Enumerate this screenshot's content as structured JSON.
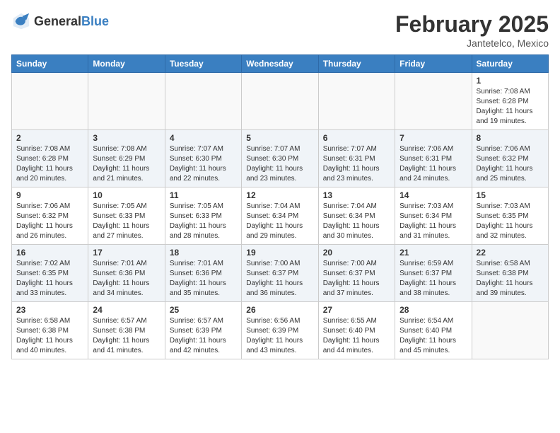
{
  "header": {
    "logo_general": "General",
    "logo_blue": "Blue",
    "month_year": "February 2025",
    "location": "Jantetelco, Mexico"
  },
  "days_of_week": [
    "Sunday",
    "Monday",
    "Tuesday",
    "Wednesday",
    "Thursday",
    "Friday",
    "Saturday"
  ],
  "weeks": [
    [
      {
        "day": "",
        "info": ""
      },
      {
        "day": "",
        "info": ""
      },
      {
        "day": "",
        "info": ""
      },
      {
        "day": "",
        "info": ""
      },
      {
        "day": "",
        "info": ""
      },
      {
        "day": "",
        "info": ""
      },
      {
        "day": "1",
        "info": "Sunrise: 7:08 AM\nSunset: 6:28 PM\nDaylight: 11 hours\nand 19 minutes."
      }
    ],
    [
      {
        "day": "2",
        "info": "Sunrise: 7:08 AM\nSunset: 6:28 PM\nDaylight: 11 hours\nand 20 minutes."
      },
      {
        "day": "3",
        "info": "Sunrise: 7:08 AM\nSunset: 6:29 PM\nDaylight: 11 hours\nand 21 minutes."
      },
      {
        "day": "4",
        "info": "Sunrise: 7:07 AM\nSunset: 6:30 PM\nDaylight: 11 hours\nand 22 minutes."
      },
      {
        "day": "5",
        "info": "Sunrise: 7:07 AM\nSunset: 6:30 PM\nDaylight: 11 hours\nand 23 minutes."
      },
      {
        "day": "6",
        "info": "Sunrise: 7:07 AM\nSunset: 6:31 PM\nDaylight: 11 hours\nand 23 minutes."
      },
      {
        "day": "7",
        "info": "Sunrise: 7:06 AM\nSunset: 6:31 PM\nDaylight: 11 hours\nand 24 minutes."
      },
      {
        "day": "8",
        "info": "Sunrise: 7:06 AM\nSunset: 6:32 PM\nDaylight: 11 hours\nand 25 minutes."
      }
    ],
    [
      {
        "day": "9",
        "info": "Sunrise: 7:06 AM\nSunset: 6:32 PM\nDaylight: 11 hours\nand 26 minutes."
      },
      {
        "day": "10",
        "info": "Sunrise: 7:05 AM\nSunset: 6:33 PM\nDaylight: 11 hours\nand 27 minutes."
      },
      {
        "day": "11",
        "info": "Sunrise: 7:05 AM\nSunset: 6:33 PM\nDaylight: 11 hours\nand 28 minutes."
      },
      {
        "day": "12",
        "info": "Sunrise: 7:04 AM\nSunset: 6:34 PM\nDaylight: 11 hours\nand 29 minutes."
      },
      {
        "day": "13",
        "info": "Sunrise: 7:04 AM\nSunset: 6:34 PM\nDaylight: 11 hours\nand 30 minutes."
      },
      {
        "day": "14",
        "info": "Sunrise: 7:03 AM\nSunset: 6:34 PM\nDaylight: 11 hours\nand 31 minutes."
      },
      {
        "day": "15",
        "info": "Sunrise: 7:03 AM\nSunset: 6:35 PM\nDaylight: 11 hours\nand 32 minutes."
      }
    ],
    [
      {
        "day": "16",
        "info": "Sunrise: 7:02 AM\nSunset: 6:35 PM\nDaylight: 11 hours\nand 33 minutes."
      },
      {
        "day": "17",
        "info": "Sunrise: 7:01 AM\nSunset: 6:36 PM\nDaylight: 11 hours\nand 34 minutes."
      },
      {
        "day": "18",
        "info": "Sunrise: 7:01 AM\nSunset: 6:36 PM\nDaylight: 11 hours\nand 35 minutes."
      },
      {
        "day": "19",
        "info": "Sunrise: 7:00 AM\nSunset: 6:37 PM\nDaylight: 11 hours\nand 36 minutes."
      },
      {
        "day": "20",
        "info": "Sunrise: 7:00 AM\nSunset: 6:37 PM\nDaylight: 11 hours\nand 37 minutes."
      },
      {
        "day": "21",
        "info": "Sunrise: 6:59 AM\nSunset: 6:37 PM\nDaylight: 11 hours\nand 38 minutes."
      },
      {
        "day": "22",
        "info": "Sunrise: 6:58 AM\nSunset: 6:38 PM\nDaylight: 11 hours\nand 39 minutes."
      }
    ],
    [
      {
        "day": "23",
        "info": "Sunrise: 6:58 AM\nSunset: 6:38 PM\nDaylight: 11 hours\nand 40 minutes."
      },
      {
        "day": "24",
        "info": "Sunrise: 6:57 AM\nSunset: 6:38 PM\nDaylight: 11 hours\nand 41 minutes."
      },
      {
        "day": "25",
        "info": "Sunrise: 6:57 AM\nSunset: 6:39 PM\nDaylight: 11 hours\nand 42 minutes."
      },
      {
        "day": "26",
        "info": "Sunrise: 6:56 AM\nSunset: 6:39 PM\nDaylight: 11 hours\nand 43 minutes."
      },
      {
        "day": "27",
        "info": "Sunrise: 6:55 AM\nSunset: 6:40 PM\nDaylight: 11 hours\nand 44 minutes."
      },
      {
        "day": "28",
        "info": "Sunrise: 6:54 AM\nSunset: 6:40 PM\nDaylight: 11 hours\nand 45 minutes."
      },
      {
        "day": "",
        "info": ""
      }
    ]
  ]
}
